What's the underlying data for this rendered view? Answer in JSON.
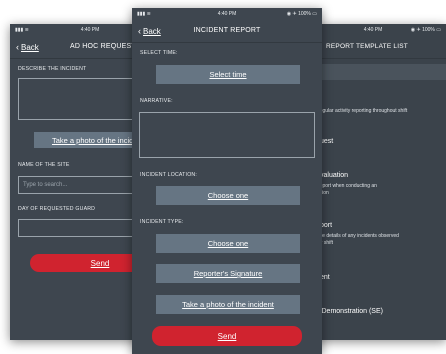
{
  "status": {
    "time": "4:40 PM",
    "battery": "100%"
  },
  "left": {
    "back": "Back",
    "title": "AD HOC REQUEST",
    "describe_label": "DESCRIBE THE INCIDENT",
    "photo_button": "Take a photo of the incident",
    "site_label": "NAME OF THE SITE",
    "site_placeholder": "Type to search...",
    "guard_label": "DAY OF REQUESTED GUARD",
    "send": "Send"
  },
  "center": {
    "back": "Back",
    "title": "INCIDENT REPORT",
    "select_time_label": "SELECT TIME:",
    "select_time_button": "Select time",
    "narrative_label": "NARRATIVE:",
    "location_label": "INCIDENT LOCATION:",
    "location_button": "Choose one",
    "type_label": "INCIDENT TYPE:",
    "type_button": "Choose one",
    "signature_button": "Reporter's Signature",
    "photo_button": "Take a photo of the incident",
    "send": "Send"
  },
  "right": {
    "title": "REPORT TEMPLATE LIST",
    "items": [
      {
        "title": "",
        "desc": "regular activity reporting throughout shift"
      },
      {
        "title": "uest",
        "desc": ""
      },
      {
        "title": "valuation",
        "desc": "report when conducting an\nation"
      },
      {
        "title": "port",
        "desc": "the details of any incidents observed\nur shift"
      },
      {
        "title": "ent",
        "desc": ""
      },
      {
        "title": "l Demonstration (SE)",
        "desc": ""
      }
    ]
  },
  "colors": {
    "screen_bg": "#3e464f",
    "button_bg": "#667583",
    "send_bg": "#d0232f"
  }
}
